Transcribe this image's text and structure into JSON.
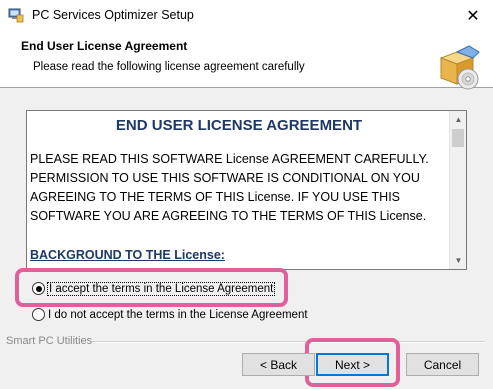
{
  "window": {
    "title": "PC Services Optimizer Setup",
    "close_glyph": "✕"
  },
  "banner": {
    "title": "End User License Agreement",
    "subtitle": "Please read the following license agreement carefully",
    "icon": "setup-box-disc-icon"
  },
  "license": {
    "heading": "END USER LICENSE AGREEMENT",
    "paragraph1": "PLEASE READ THIS SOFTWARE License AGREEMENT CAREFULLY. PERMISSION TO USE THIS SOFTWARE IS CONDITIONAL ON YOU AGREEING TO THE TERMS OF THIS License. IF YOU USE THIS SOFTWARE YOU ARE AGREEING TO THE TERMS OF THIS License.",
    "section_heading": "BACKGROUND TO THE License:"
  },
  "options": {
    "accept_label": "I accept the terms in the License Agreement",
    "decline_label": "I do not accept the terms in the License Agreement",
    "selected": "accept"
  },
  "footer": {
    "brand": "Smart PC Utilities",
    "back_label": "< Back",
    "next_label": "Next >",
    "cancel_label": "Cancel"
  },
  "colors": {
    "highlight": "#e0609a",
    "heading_blue": "#1f3864",
    "focus_blue": "#0078d7"
  }
}
